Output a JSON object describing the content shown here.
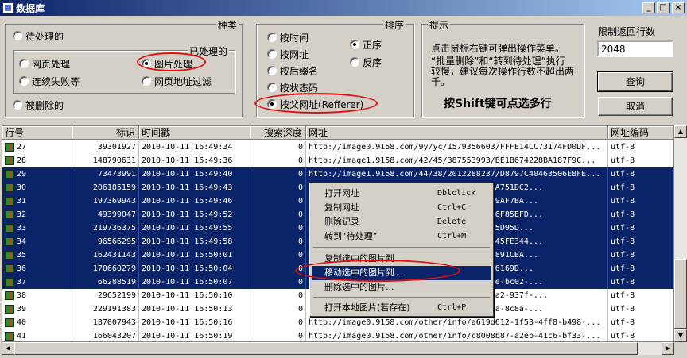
{
  "window": {
    "title": "数据库",
    "buttons": [
      "_",
      "□",
      "×"
    ]
  },
  "kind": {
    "legend": "种类",
    "pending": "待处理的",
    "processed_legend": "已处理的",
    "web": "网页处理",
    "image": "图片处理",
    "broken": "连续失败等",
    "urlfilter": "网页地址过滤",
    "deleted": "被删除的",
    "selected": "图片处理"
  },
  "order": {
    "legend": "排序",
    "by_time": "按时间",
    "by_url": "按网址",
    "by_suffix": "按后缀名",
    "by_status": "按状态码",
    "by_referer": "按父网址(Refferer)",
    "asc": "正序",
    "desc": "反序",
    "selected_field": "按父网址(Refferer)",
    "selected_dir": "正序"
  },
  "tips": {
    "legend": "提示",
    "line1": "点击鼠标右键可弹出操作菜单。",
    "line2": "“批量删除”和“转到待处理”执行较慢，建议每次操作行数不超出两千。",
    "shift": "按Shift键可点选多行"
  },
  "limit": {
    "label": "限制返回行数",
    "value": "2048"
  },
  "buttons": {
    "query": "查询",
    "cancel": "取消"
  },
  "columns": [
    "行号",
    "标识",
    "时间戳",
    "搜索深度",
    "网址",
    "网址编码"
  ],
  "rows": [
    {
      "n": "27",
      "id": "39301927",
      "ts": "2010-10-11 16:49:34",
      "depth": "0",
      "url": "http://image0.9158.com/9y/yc/1579356603/FFFE14CC73174FD0DF...",
      "enc": "utf-8",
      "sel": false
    },
    {
      "n": "28",
      "id": "148790631",
      "ts": "2010-10-11 16:49:36",
      "depth": "0",
      "url": "http://image1.9158.com/42/45/387553993/BE1B674228BA187F9C...",
      "enc": "utf-8",
      "sel": false
    },
    {
      "n": "29",
      "id": "73473991",
      "ts": "2010-10-11 16:49:40",
      "depth": "0",
      "url": "http://image1.9158.com/44/38/2012288237/D8797C40463506E8FE...",
      "enc": "utf-8",
      "sel": true
    },
    {
      "n": "30",
      "id": "206185159",
      "ts": "2010-10-11 16:49:43",
      "depth": "0",
      "url": "http://image0.9158.com/../29A119C3ED4A2A751DC2...",
      "enc": "utf-8",
      "sel": true
    },
    {
      "n": "31",
      "id": "197369943",
      "ts": "2010-10-11 16:49:46",
      "depth": "0",
      "url": "http://image0.9158.com/../BD42CDCEB60289AF7BA...",
      "enc": "utf-8",
      "sel": true
    },
    {
      "n": "32",
      "id": "49399047",
      "ts": "2010-10-11 16:49:52",
      "depth": "0",
      "url": "http://image0.9158.com/../786A5EA2A246E6F85EFD...",
      "enc": "utf-8",
      "sel": true
    },
    {
      "n": "33",
      "id": "219736375",
      "ts": "2010-10-11 16:49:55",
      "depth": "0",
      "url": "http://image0.9158.com/../FC160ED20A2585D95D...",
      "enc": "utf-8",
      "sel": true
    },
    {
      "n": "34",
      "id": "96566295",
      "ts": "2010-10-11 16:49:58",
      "depth": "0",
      "url": "http://image0.9158.com/../00E0495971OF045FE344...",
      "enc": "utf-8",
      "sel": true
    },
    {
      "n": "35",
      "id": "162431143",
      "ts": "2010-10-11 16:50:01",
      "depth": "0",
      "url": "http://image0.9158.com/../2146E40B50190891CBA...",
      "enc": "utf-8",
      "sel": true
    },
    {
      "n": "36",
      "id": "170660279",
      "ts": "2010-10-11 16:50:04",
      "depth": "0",
      "url": "http://image0.9158.com/../BF748804571516169D...",
      "enc": "utf-8",
      "sel": true
    },
    {
      "n": "37",
      "id": "66288519",
      "ts": "2010-10-11 16:50:07",
      "depth": "0",
      "url": "http://image0.9158.com/../4994-0130-4aee-bc02-...",
      "enc": "utf-8",
      "sel": true
    },
    {
      "n": "38",
      "id": "29652199",
      "ts": "2010-10-11 16:50:10",
      "depth": "0",
      "url": "http://image0.9158.com/../1e612-6715-43a2-937f-...",
      "enc": "utf-8",
      "sel": false
    },
    {
      "n": "39",
      "id": "229191383",
      "ts": "2010-10-11 16:50:13",
      "depth": "0",
      "url": "http://image0.9158.com/../af07-715a-486a-8c8a-...",
      "enc": "utf-8",
      "sel": false
    },
    {
      "n": "40",
      "id": "187007943",
      "ts": "2010-10-11 16:50:16",
      "depth": "0",
      "url": "http://image0.9158.com/other/info/a619d612-1f53-4ff8-b498-...",
      "enc": "utf-8",
      "sel": false
    },
    {
      "n": "41",
      "id": "166043207",
      "ts": "2010-10-11 16:50:19",
      "depth": "0",
      "url": "http://image0.9158.com/other/info/c8008b87-a2eb-41c6-bf33-...",
      "enc": "utf-8",
      "sel": false
    }
  ],
  "context_menu": [
    {
      "label": "打开网址",
      "key": "Dblclick"
    },
    {
      "label": "复制网址",
      "key": "Ctrl+C"
    },
    {
      "label": "删除记录",
      "key": "Delete"
    },
    {
      "label": "转到“待处理”",
      "key": "Ctrl+M"
    },
    {
      "label": "复制选中的图片到...",
      "key": ""
    },
    {
      "label": "移动选中的图片到...",
      "key": ""
    },
    {
      "label": "删除选中的图片...",
      "key": ""
    },
    {
      "label": "打开本地图片(若存在)",
      "key": "Ctrl+P"
    }
  ]
}
